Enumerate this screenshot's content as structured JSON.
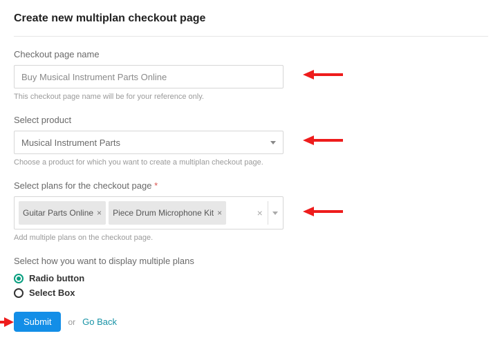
{
  "title": "Create new multiplan checkout page",
  "page_name": {
    "label": "Checkout page name",
    "value": "Buy Musical Instrument Parts Online",
    "helper": "This checkout page name will be for your reference only."
  },
  "product": {
    "label": "Select product",
    "selected": "Musical Instrument Parts",
    "helper": "Choose a product for which you want to create a multiplan checkout page."
  },
  "plans": {
    "label": "Select plans for the checkout page",
    "required_mark": "*",
    "chips": [
      "Guitar Parts Online",
      "Piece Drum Microphone Kit"
    ],
    "helper": "Add multiple plans on the checkout page."
  },
  "display": {
    "label": "Select how you want to display multiple plans",
    "options": [
      {
        "label": "Radio button",
        "selected": true
      },
      {
        "label": "Select Box",
        "selected": false
      }
    ]
  },
  "actions": {
    "submit": "Submit",
    "or": "or",
    "go_back": "Go Back"
  }
}
